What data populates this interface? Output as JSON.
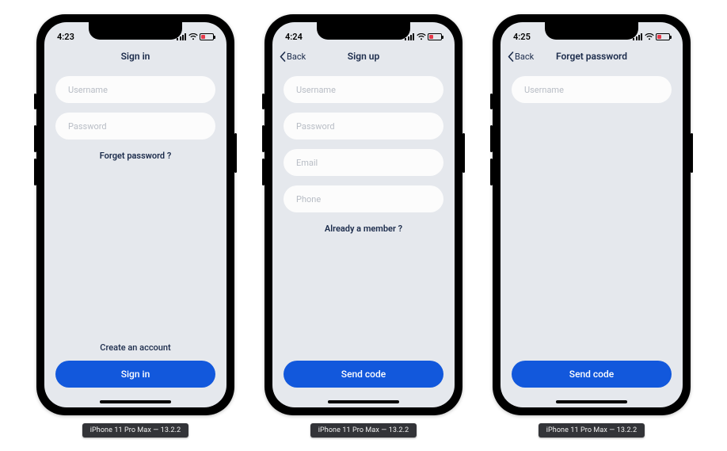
{
  "device_caption": "iPhone 11 Pro Max — 13.2.2",
  "screens": [
    {
      "time": "4:23",
      "back": null,
      "title": "Sign in",
      "inputs": [
        {
          "placeholder": "Username"
        },
        {
          "placeholder": "Password"
        }
      ],
      "link_below_inputs": "Forget password ?",
      "secondary_link": "Create an account",
      "primary_button": "Sign in"
    },
    {
      "time": "4:24",
      "back": "Back",
      "title": "Sign up",
      "inputs": [
        {
          "placeholder": "Username"
        },
        {
          "placeholder": "Password"
        },
        {
          "placeholder": "Email"
        },
        {
          "placeholder": "Phone"
        }
      ],
      "link_below_inputs": "Already a member ?",
      "secondary_link": null,
      "primary_button": "Send code"
    },
    {
      "time": "4:25",
      "back": "Back",
      "title": "Forget password",
      "inputs": [
        {
          "placeholder": "Username"
        }
      ],
      "link_below_inputs": null,
      "secondary_link": null,
      "primary_button": "Send code"
    }
  ]
}
